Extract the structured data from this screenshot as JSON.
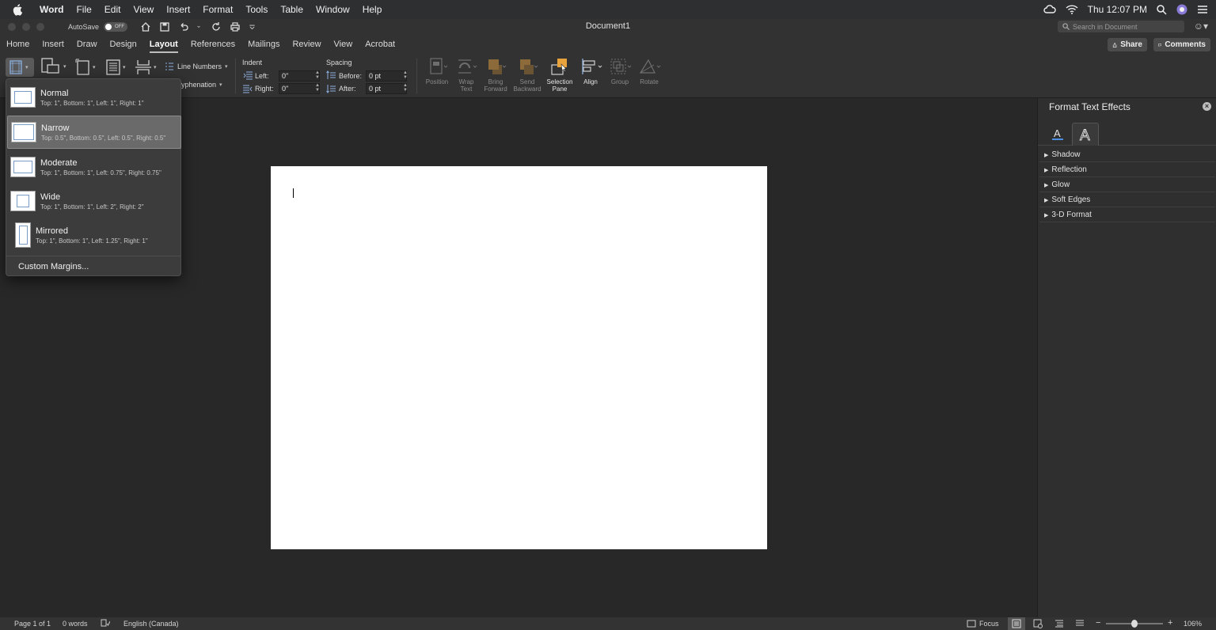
{
  "menubar": {
    "app_name": "Word",
    "items": [
      "File",
      "Edit",
      "View",
      "Insert",
      "Format",
      "Tools",
      "Table",
      "Window",
      "Help"
    ],
    "clock": "Thu 12:07 PM"
  },
  "titlebar": {
    "autosave_label": "AutoSave",
    "autosave_state": "OFF",
    "document_title": "Document1",
    "search_placeholder": "Search in Document"
  },
  "tabs": [
    "Home",
    "Insert",
    "Draw",
    "Design",
    "Layout",
    "References",
    "Mailings",
    "Review",
    "View",
    "Acrobat"
  ],
  "active_tab": "Layout",
  "share_label": "Share",
  "comments_label": "Comments",
  "ribbon": {
    "line_numbers": "Line Numbers",
    "hyphenation": "yphenation",
    "indent_label": "Indent",
    "indent_left_label": "Left:",
    "indent_left_value": "0\"",
    "indent_right_label": "Right:",
    "indent_right_value": "0\"",
    "spacing_label": "Spacing",
    "spacing_before_label": "Before:",
    "spacing_before_value": "0 pt",
    "spacing_after_label": "After:",
    "spacing_after_value": "0 pt",
    "arrange": [
      {
        "label1": "Position",
        "label2": ""
      },
      {
        "label1": "Wrap",
        "label2": "Text"
      },
      {
        "label1": "Bring",
        "label2": "Forward"
      },
      {
        "label1": "Send",
        "label2": "Backward"
      },
      {
        "label1": "Selection",
        "label2": "Pane"
      },
      {
        "label1": "Align",
        "label2": ""
      },
      {
        "label1": "Group",
        "label2": ""
      },
      {
        "label1": "Rotate",
        "label2": ""
      }
    ]
  },
  "margins_menu": {
    "items": [
      {
        "name": "Normal",
        "desc": "Top: 1\", Bottom: 1\", Left: 1\", Right: 1\""
      },
      {
        "name": "Narrow",
        "desc": "Top: 0.5\", Bottom: 0.5\", Left: 0.5\", Right: 0.5\""
      },
      {
        "name": "Moderate",
        "desc": "Top: 1\", Bottom: 1\", Left: 0.75\", Right: 0.75\""
      },
      {
        "name": "Wide",
        "desc": "Top: 1\", Bottom: 1\", Left: 2\", Right: 2\""
      },
      {
        "name": "Mirrored",
        "desc": "Top: 1\", Bottom: 1\", Left: 1.25\", Right: 1\""
      }
    ],
    "selected": "Narrow",
    "custom": "Custom Margins..."
  },
  "pane": {
    "title": "Format Text Effects",
    "sections": [
      "Shadow",
      "Reflection",
      "Glow",
      "Soft Edges",
      "3-D Format"
    ]
  },
  "statusbar": {
    "page": "Page 1 of 1",
    "words": "0 words",
    "language": "English (Canada)",
    "focus": "Focus",
    "zoom": "106%"
  },
  "colors": {
    "accent_orange": "#e8a33c",
    "chrome": "#323232",
    "canvas": "#282828"
  }
}
